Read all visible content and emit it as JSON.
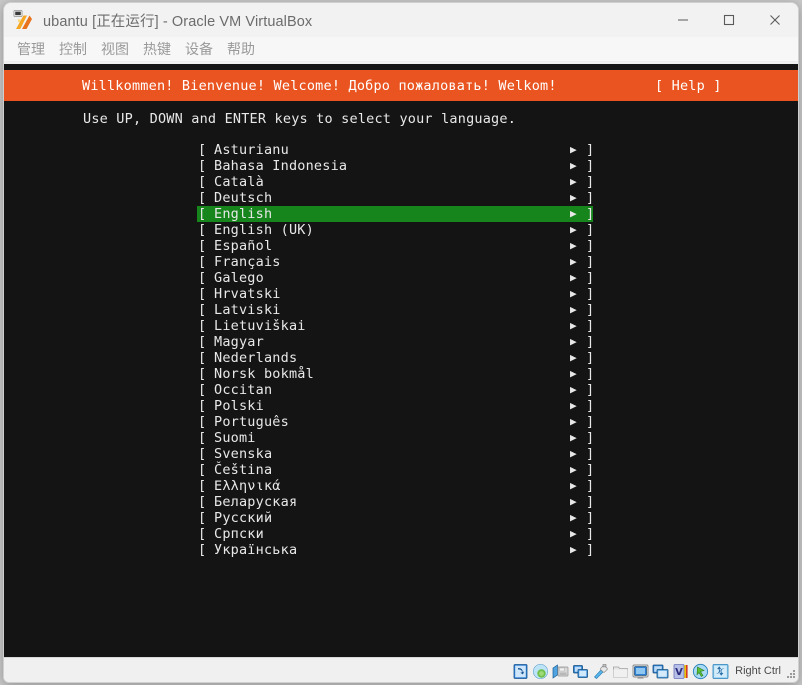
{
  "window": {
    "title": "ubantu [正在运行] - Oracle VM VirtualBox",
    "logo_icon": "virtualbox-logo-icon",
    "controls": {
      "minimize": "minimize-icon",
      "maximize": "maximize-icon",
      "close": "close-icon"
    }
  },
  "menu": {
    "items": [
      {
        "label": "管理"
      },
      {
        "label": "控制"
      },
      {
        "label": "视图"
      },
      {
        "label": "热键"
      },
      {
        "label": "设备"
      },
      {
        "label": "帮助"
      }
    ]
  },
  "vm": {
    "banner": {
      "text": "Willkommen! Bienvenue! Welcome! Добро пожаловать! Welkom!",
      "help": "[ Help ]",
      "bg_color": "#e95420",
      "fg_color": "#ffffff"
    },
    "instruction": "Use UP, DOWN and ENTER keys to select your language.",
    "list": {
      "left_bracket": "[",
      "right_bracket": "]",
      "arrow": "▶",
      "selected_index": 4,
      "selected_bg": "#16851c",
      "items": [
        {
          "label": "Asturianu"
        },
        {
          "label": "Bahasa Indonesia"
        },
        {
          "label": "Català"
        },
        {
          "label": "Deutsch"
        },
        {
          "label": "English"
        },
        {
          "label": "English (UK)"
        },
        {
          "label": "Español"
        },
        {
          "label": "Français"
        },
        {
          "label": "Galego"
        },
        {
          "label": "Hrvatski"
        },
        {
          "label": "Latviski"
        },
        {
          "label": "Lietuviškai"
        },
        {
          "label": "Magyar"
        },
        {
          "label": "Nederlands"
        },
        {
          "label": "Norsk bokmål"
        },
        {
          "label": "Occitan"
        },
        {
          "label": "Polski"
        },
        {
          "label": "Português"
        },
        {
          "label": "Suomi"
        },
        {
          "label": "Svenska"
        },
        {
          "label": "Čeština"
        },
        {
          "label": "Ελληνικά"
        },
        {
          "label": "Беларуская"
        },
        {
          "label": "Русский"
        },
        {
          "label": "Српски"
        },
        {
          "label": "Українська"
        }
      ]
    },
    "screen_bg": "#141414",
    "screen_fg": "#e8e8e8"
  },
  "status_bar": {
    "host_key_label": "Right Ctrl",
    "icons": [
      {
        "name": "hard-disk-icon"
      },
      {
        "name": "optical-disk-icon"
      },
      {
        "name": "floppy-disk-icon"
      },
      {
        "name": "network-icon"
      },
      {
        "name": "usb-icon"
      },
      {
        "name": "shared-folder-icon"
      },
      {
        "name": "display-icon"
      },
      {
        "name": "recording-icon"
      },
      {
        "name": "virtualization-icon"
      },
      {
        "name": "mouse-integration-icon"
      },
      {
        "name": "keyboard-icon"
      }
    ]
  }
}
